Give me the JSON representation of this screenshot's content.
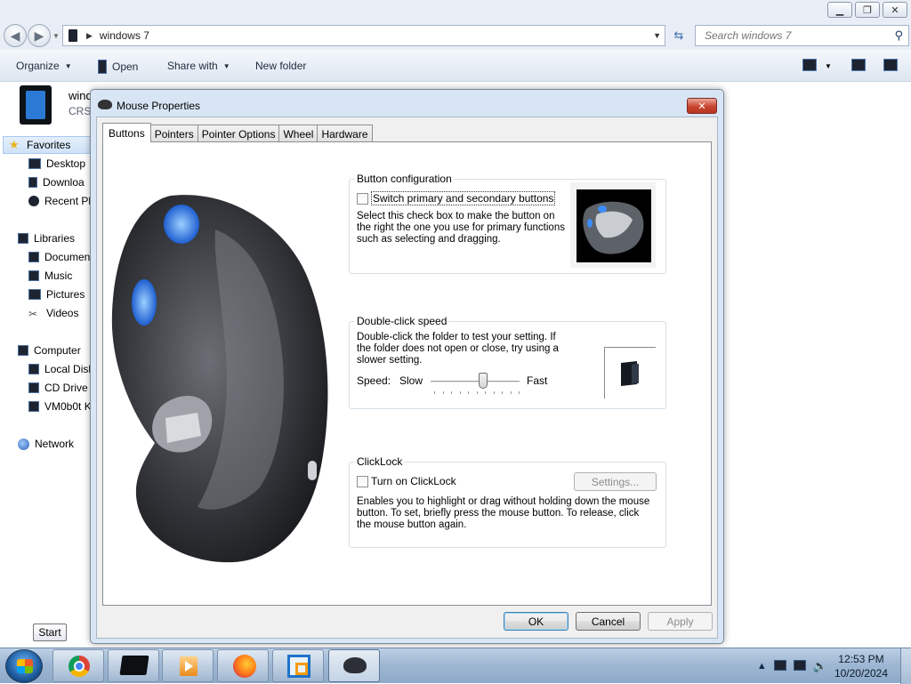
{
  "explorer": {
    "address": {
      "crumb": "windows 7"
    },
    "search": {
      "placeholder": "Search windows 7"
    },
    "toolbar": {
      "organize": "Organize",
      "open": "Open",
      "share_with": "Share with",
      "new_folder": "New folder"
    },
    "details": {
      "name": "wind",
      "sub": "CRS"
    },
    "nav": {
      "favorites": "Favorites",
      "desktop": "Desktop",
      "downloads": "Downloa",
      "recent": "Recent Pl",
      "libraries": "Libraries",
      "documents": "Documen",
      "music": "Music",
      "pictures": "Pictures",
      "videos": "Videos",
      "computer": "Computer",
      "local_disk": "Local Disl",
      "cd_drive": "CD Drive",
      "vm": "VM0b0t K",
      "network": "Network"
    }
  },
  "dialog": {
    "title": "Mouse Properties",
    "close": "✕",
    "tabs": [
      "Buttons",
      "Pointers",
      "Pointer Options",
      "Wheel",
      "Hardware"
    ],
    "button_config": {
      "label": "Button configuration",
      "checkbox": "Switch primary and secondary buttons",
      "desc": "Select this check box to make the button on the right the one you use for primary functions such as selecting and dragging."
    },
    "double_click": {
      "label": "Double-click speed",
      "desc": "Double-click the folder to test your setting. If the folder does not open or close, try using a slower setting.",
      "speed_label": "Speed:",
      "slow": "Slow",
      "fast": "Fast",
      "speed_value": 0.6
    },
    "clicklock": {
      "label": "ClickLock",
      "checkbox": "Turn on ClickLock",
      "settings": "Settings...",
      "desc": "Enables you to highlight or drag without holding down the mouse button. To set, briefly press the mouse button. To release, click the mouse button again."
    },
    "buttons": {
      "ok": "OK",
      "cancel": "Cancel",
      "apply": "Apply"
    }
  },
  "taskbar": {
    "start_tooltip": "Start",
    "time": "12:53 PM",
    "date": "10/20/2024",
    "tray_arrow": "▲"
  }
}
